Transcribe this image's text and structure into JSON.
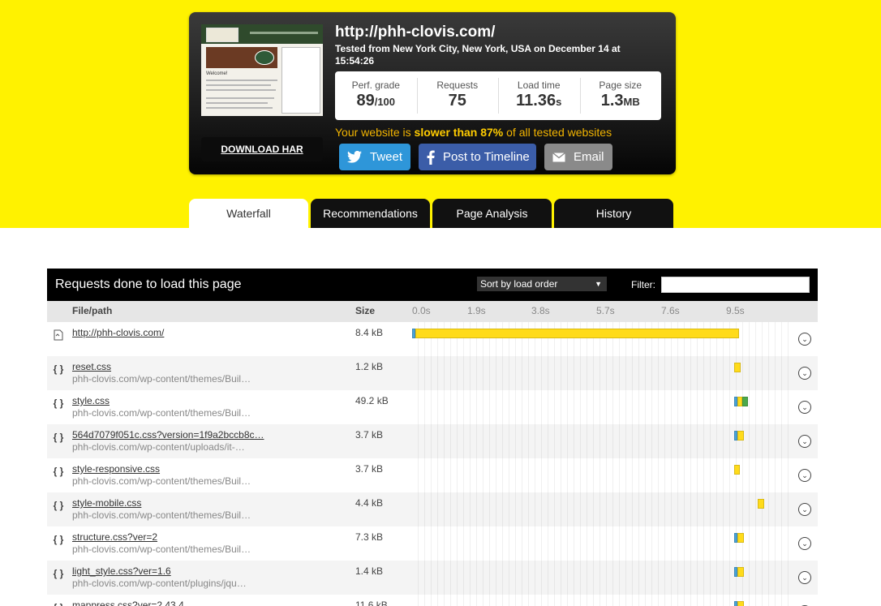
{
  "summary": {
    "url": "http://phh-clovis.com/",
    "tested": "Tested from New York City, New York, USA on December 14 at 15:54:26",
    "download_har": "DOWNLOAD HAR",
    "metrics": [
      {
        "label": "Perf. grade",
        "value": "89",
        "unit": "/100"
      },
      {
        "label": "Requests",
        "value": "75",
        "unit": ""
      },
      {
        "label": "Load time",
        "value": "11.36",
        "unit": "s"
      },
      {
        "label": "Page size",
        "value": "1.3",
        "unit": "MB"
      }
    ],
    "comparison_prefix": "Your website is ",
    "comparison_bold": "slower than 87%",
    "comparison_suffix": " of all tested websites"
  },
  "share": {
    "tweet": "Tweet",
    "timeline": "Post to Timeline",
    "email": "Email"
  },
  "tabs": [
    "Waterfall",
    "Recommendations",
    "Page Analysis",
    "History"
  ],
  "waterfall": {
    "title": "Requests done to load this page",
    "sort_value": "Sort by load order",
    "filter_label": "Filter:",
    "columns": {
      "file": "File/path",
      "size": "Size"
    },
    "ticks": [
      "0.0s",
      "1.9s",
      "3.8s",
      "5.7s",
      "7.6s",
      "9.5s"
    ],
    "rows": [
      {
        "icon": "page-icon",
        "name": "http://phh-clovis.com/",
        "path": "",
        "size": "8.4 kB",
        "bar": [
          {
            "start": 0.0,
            "dur": 0.09,
            "color": "#4aa3d8"
          },
          {
            "start": 0.09,
            "dur": 9.5,
            "color": "#ffdb1a"
          }
        ]
      },
      {
        "icon": "css-icon",
        "name": "reset.css",
        "path": "phh-clovis.com/wp-content/themes/Buil…",
        "size": "1.2 kB",
        "bar": [
          {
            "start": 9.45,
            "dur": 0.2,
            "color": "#ffdb1a"
          }
        ]
      },
      {
        "icon": "css-icon",
        "name": "style.css",
        "path": "phh-clovis.com/wp-content/themes/Buil…",
        "size": "49.2 kB",
        "bar": [
          {
            "start": 9.45,
            "dur": 0.1,
            "color": "#4aa3d8"
          },
          {
            "start": 9.55,
            "dur": 0.15,
            "color": "#ffdb1a"
          },
          {
            "start": 9.7,
            "dur": 0.15,
            "color": "#4ba84a"
          }
        ]
      },
      {
        "icon": "css-icon",
        "name": "564d7079f051c.css?version=1f9a2bccb8c…",
        "path": "phh-clovis.com/wp-content/uploads/it-…",
        "size": "3.7 kB",
        "bar": [
          {
            "start": 9.45,
            "dur": 0.1,
            "color": "#4aa3d8"
          },
          {
            "start": 9.55,
            "dur": 0.2,
            "color": "#ffdb1a"
          }
        ]
      },
      {
        "icon": "css-icon",
        "name": "style-responsive.css",
        "path": "phh-clovis.com/wp-content/themes/Buil…",
        "size": "3.7 kB",
        "bar": [
          {
            "start": 9.45,
            "dur": 0.18,
            "color": "#ffdb1a"
          }
        ]
      },
      {
        "icon": "css-icon",
        "name": "style-mobile.css",
        "path": "phh-clovis.com/wp-content/themes/Buil…",
        "size": "4.4 kB",
        "bar": [
          {
            "start": 10.15,
            "dur": 0.18,
            "color": "#ffdb1a"
          }
        ]
      },
      {
        "icon": "css-icon",
        "name": "structure.css?ver=2",
        "path": "phh-clovis.com/wp-content/themes/Buil…",
        "size": "7.3 kB",
        "bar": [
          {
            "start": 9.45,
            "dur": 0.1,
            "color": "#4aa3d8"
          },
          {
            "start": 9.55,
            "dur": 0.2,
            "color": "#ffdb1a"
          }
        ]
      },
      {
        "icon": "css-icon",
        "name": "light_style.css?ver=1.6",
        "path": "phh-clovis.com/wp-content/plugins/jqu…",
        "size": "1.4 kB",
        "bar": [
          {
            "start": 9.45,
            "dur": 0.1,
            "color": "#4aa3d8"
          },
          {
            "start": 9.55,
            "dur": 0.2,
            "color": "#ffdb1a"
          }
        ]
      },
      {
        "icon": "css-icon",
        "name": "mappress.css?ver=2.43.4",
        "path": "",
        "size": "11.6 kB",
        "bar": [
          {
            "start": 9.45,
            "dur": 0.1,
            "color": "#4aa3d8"
          },
          {
            "start": 9.55,
            "dur": 0.2,
            "color": "#ffdb1a"
          }
        ]
      }
    ]
  }
}
